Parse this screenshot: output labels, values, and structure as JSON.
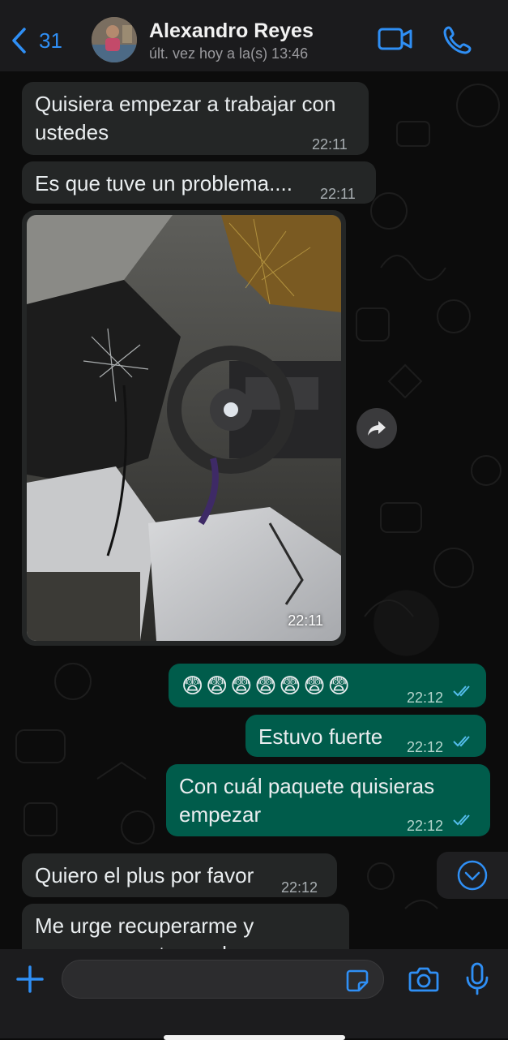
{
  "header": {
    "back_count": "31",
    "contact_name": "Alexandro Reyes",
    "status": "últ. vez hoy a la(s) 13:46",
    "accent": "#2f8ff5"
  },
  "messages": [
    {
      "dir": "in",
      "text_lines": [
        "Quisiera empezar a trabajar con",
        "ustedes"
      ],
      "time": "22:11"
    },
    {
      "dir": "in",
      "text": "Es que tuve un problema....",
      "time": "22:11"
    },
    {
      "dir": "in",
      "type": "photo",
      "time": "22:11"
    },
    {
      "dir": "out",
      "text": "😨😨😨😨😨😨😨",
      "time": "22:12",
      "read": true
    },
    {
      "dir": "out",
      "text": "Estuvo fuerte",
      "time": "22:12",
      "read": true
    },
    {
      "dir": "out",
      "text_lines": [
        "Con cuál paquete quisieras",
        "empezar"
      ],
      "time": "22:12",
      "read": true
    },
    {
      "dir": "in",
      "text": "Quiero el plus por favor",
      "time": "22:12"
    },
    {
      "dir": "in",
      "text_lines": [
        "Me urge recuperarme y",
        "comprarme otro coche"
      ]
    }
  ],
  "colors": {
    "incoming_bubble": "#242626",
    "outgoing_bubble": "#005c4b",
    "read_ticks": "#53bdeb"
  },
  "icons": {
    "header": [
      "chevron-left-icon",
      "video-camera-icon",
      "phone-icon"
    ],
    "composer": [
      "plus-icon",
      "sticker-icon",
      "camera-icon",
      "microphone-icon"
    ],
    "chat": [
      "forward-icon",
      "chevron-down-icon"
    ]
  }
}
